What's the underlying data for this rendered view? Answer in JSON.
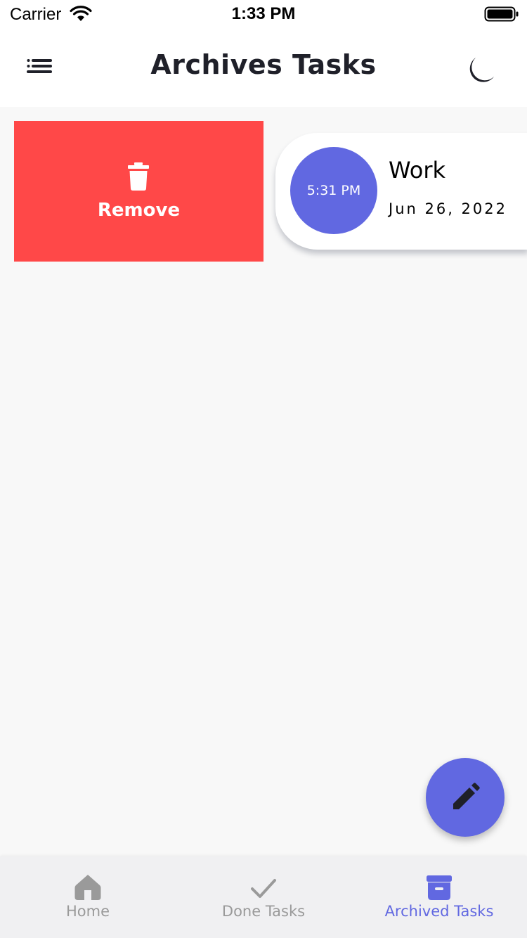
{
  "status_bar": {
    "carrier": "Carrier",
    "time": "1:33 PM"
  },
  "app_bar": {
    "title": "Archives Tasks",
    "menu_icon": "menu-icon",
    "theme_icon": "moon-icon"
  },
  "swipe_action": {
    "label": "Remove",
    "icon": "trash-icon",
    "color": "#ff4848"
  },
  "tasks": [
    {
      "time": "5:31 PM",
      "title": "Work",
      "date": "Jun 26, 2022"
    }
  ],
  "fab": {
    "icon": "pencil-icon",
    "color": "#6168e1"
  },
  "bottom_nav": {
    "items": [
      {
        "label": "Home",
        "icon": "home-icon",
        "active": false
      },
      {
        "label": "Done Tasks",
        "icon": "check-icon",
        "active": false
      },
      {
        "label": "Archived Tasks",
        "icon": "archive-icon",
        "active": true
      }
    ],
    "active_color": "#6168e1",
    "inactive_color": "#9a9a9a"
  },
  "colors": {
    "accent": "#6168e1",
    "danger": "#ff4848",
    "background": "#f8f8f8"
  }
}
